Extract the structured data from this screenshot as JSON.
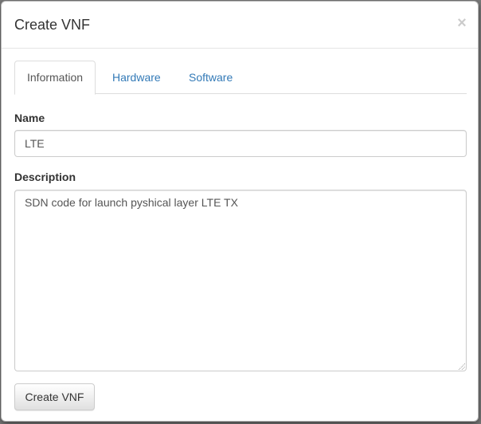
{
  "modal": {
    "title": "Create VNF",
    "close_symbol": "×"
  },
  "tabs": [
    {
      "label": "Information",
      "active": true
    },
    {
      "label": "Hardware",
      "active": false
    },
    {
      "label": "Software",
      "active": false
    }
  ],
  "form": {
    "name_label": "Name",
    "name_value": "LTE",
    "description_label": "Description",
    "description_value": "SDN code for launch pyshical layer LTE TX",
    "submit_label": "Create VNF"
  },
  "colors": {
    "link": "#337ab7",
    "border": "#dddddd",
    "backdrop": "#7a7a7a"
  },
  "icons": {
    "close": "close-icon",
    "resize": "resize-grip-icon"
  }
}
